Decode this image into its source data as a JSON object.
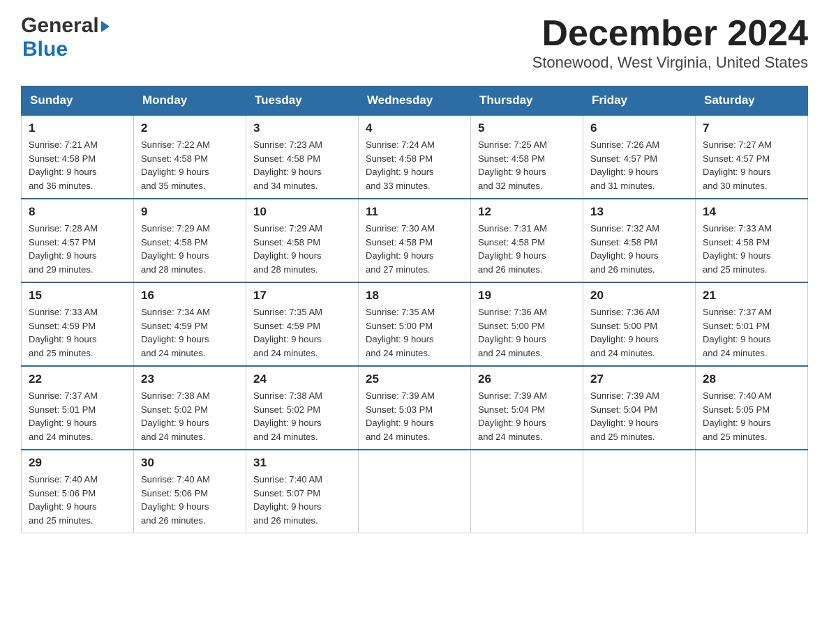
{
  "header": {
    "logo_general": "General",
    "logo_blue": "Blue",
    "title": "December 2024",
    "subtitle": "Stonewood, West Virginia, United States"
  },
  "calendar": {
    "days_of_week": [
      "Sunday",
      "Monday",
      "Tuesday",
      "Wednesday",
      "Thursday",
      "Friday",
      "Saturday"
    ],
    "weeks": [
      [
        {
          "day": "1",
          "sunrise": "7:21 AM",
          "sunset": "4:58 PM",
          "daylight": "9 hours and 36 minutes."
        },
        {
          "day": "2",
          "sunrise": "7:22 AM",
          "sunset": "4:58 PM",
          "daylight": "9 hours and 35 minutes."
        },
        {
          "day": "3",
          "sunrise": "7:23 AM",
          "sunset": "4:58 PM",
          "daylight": "9 hours and 34 minutes."
        },
        {
          "day": "4",
          "sunrise": "7:24 AM",
          "sunset": "4:58 PM",
          "daylight": "9 hours and 33 minutes."
        },
        {
          "day": "5",
          "sunrise": "7:25 AM",
          "sunset": "4:58 PM",
          "daylight": "9 hours and 32 minutes."
        },
        {
          "day": "6",
          "sunrise": "7:26 AM",
          "sunset": "4:57 PM",
          "daylight": "9 hours and 31 minutes."
        },
        {
          "day": "7",
          "sunrise": "7:27 AM",
          "sunset": "4:57 PM",
          "daylight": "9 hours and 30 minutes."
        }
      ],
      [
        {
          "day": "8",
          "sunrise": "7:28 AM",
          "sunset": "4:57 PM",
          "daylight": "9 hours and 29 minutes."
        },
        {
          "day": "9",
          "sunrise": "7:29 AM",
          "sunset": "4:58 PM",
          "daylight": "9 hours and 28 minutes."
        },
        {
          "day": "10",
          "sunrise": "7:29 AM",
          "sunset": "4:58 PM",
          "daylight": "9 hours and 28 minutes."
        },
        {
          "day": "11",
          "sunrise": "7:30 AM",
          "sunset": "4:58 PM",
          "daylight": "9 hours and 27 minutes."
        },
        {
          "day": "12",
          "sunrise": "7:31 AM",
          "sunset": "4:58 PM",
          "daylight": "9 hours and 26 minutes."
        },
        {
          "day": "13",
          "sunrise": "7:32 AM",
          "sunset": "4:58 PM",
          "daylight": "9 hours and 26 minutes."
        },
        {
          "day": "14",
          "sunrise": "7:33 AM",
          "sunset": "4:58 PM",
          "daylight": "9 hours and 25 minutes."
        }
      ],
      [
        {
          "day": "15",
          "sunrise": "7:33 AM",
          "sunset": "4:59 PM",
          "daylight": "9 hours and 25 minutes."
        },
        {
          "day": "16",
          "sunrise": "7:34 AM",
          "sunset": "4:59 PM",
          "daylight": "9 hours and 24 minutes."
        },
        {
          "day": "17",
          "sunrise": "7:35 AM",
          "sunset": "4:59 PM",
          "daylight": "9 hours and 24 minutes."
        },
        {
          "day": "18",
          "sunrise": "7:35 AM",
          "sunset": "5:00 PM",
          "daylight": "9 hours and 24 minutes."
        },
        {
          "day": "19",
          "sunrise": "7:36 AM",
          "sunset": "5:00 PM",
          "daylight": "9 hours and 24 minutes."
        },
        {
          "day": "20",
          "sunrise": "7:36 AM",
          "sunset": "5:00 PM",
          "daylight": "9 hours and 24 minutes."
        },
        {
          "day": "21",
          "sunrise": "7:37 AM",
          "sunset": "5:01 PM",
          "daylight": "9 hours and 24 minutes."
        }
      ],
      [
        {
          "day": "22",
          "sunrise": "7:37 AM",
          "sunset": "5:01 PM",
          "daylight": "9 hours and 24 minutes."
        },
        {
          "day": "23",
          "sunrise": "7:38 AM",
          "sunset": "5:02 PM",
          "daylight": "9 hours and 24 minutes."
        },
        {
          "day": "24",
          "sunrise": "7:38 AM",
          "sunset": "5:02 PM",
          "daylight": "9 hours and 24 minutes."
        },
        {
          "day": "25",
          "sunrise": "7:39 AM",
          "sunset": "5:03 PM",
          "daylight": "9 hours and 24 minutes."
        },
        {
          "day": "26",
          "sunrise": "7:39 AM",
          "sunset": "5:04 PM",
          "daylight": "9 hours and 24 minutes."
        },
        {
          "day": "27",
          "sunrise": "7:39 AM",
          "sunset": "5:04 PM",
          "daylight": "9 hours and 25 minutes."
        },
        {
          "day": "28",
          "sunrise": "7:40 AM",
          "sunset": "5:05 PM",
          "daylight": "9 hours and 25 minutes."
        }
      ],
      [
        {
          "day": "29",
          "sunrise": "7:40 AM",
          "sunset": "5:06 PM",
          "daylight": "9 hours and 25 minutes."
        },
        {
          "day": "30",
          "sunrise": "7:40 AM",
          "sunset": "5:06 PM",
          "daylight": "9 hours and 26 minutes."
        },
        {
          "day": "31",
          "sunrise": "7:40 AM",
          "sunset": "5:07 PM",
          "daylight": "9 hours and 26 minutes."
        },
        null,
        null,
        null,
        null
      ]
    ],
    "labels": {
      "sunrise": "Sunrise:",
      "sunset": "Sunset:",
      "daylight": "Daylight:"
    }
  }
}
